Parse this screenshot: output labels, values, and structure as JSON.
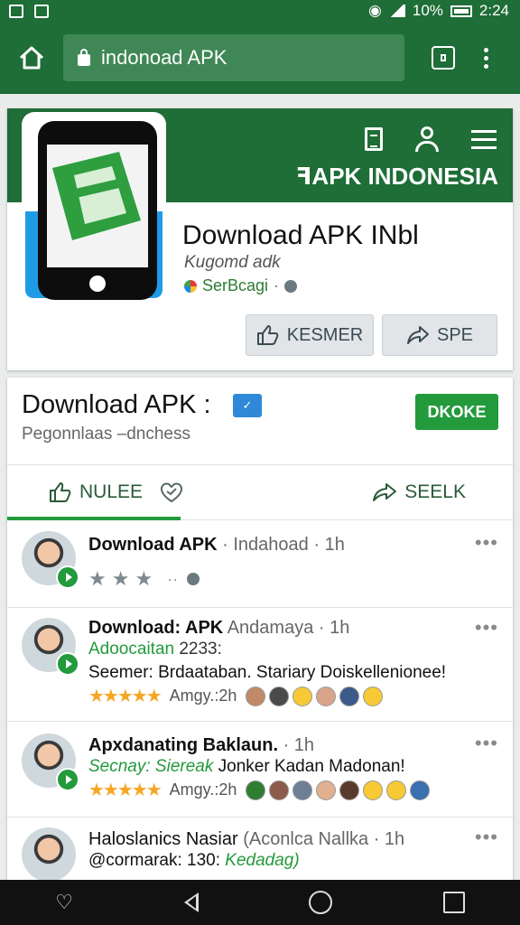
{
  "status_bar": {
    "battery": "10%",
    "time": "2:24"
  },
  "browser": {
    "url_text": "indonoad APK"
  },
  "header": {
    "brand": "ꟻAPK INDONESIA",
    "app_title": "Download APK INbl",
    "app_subtitle": "Kugomd adk",
    "app_meta": "SerBcagi",
    "btn_left": "KESMER",
    "btn_right": "SPE"
  },
  "page": {
    "title": "Download APK :",
    "subtitle": "Pegonnlaas –dnchess",
    "cta": "DKOKE",
    "tab_like": "NULEE",
    "tab_share": "SEELK"
  },
  "posts": [
    {
      "author": "Download APK",
      "meta": "· Indahoad · 1h"
    },
    {
      "author": "Download: APK",
      "meta": "Andamaya · 1h",
      "line1_a": "Adoocaitan",
      "line1_b": "2233:",
      "text": "Seemer: Brdaataban. Stariary Doiskellenionee!",
      "time": "Amgy.:2h"
    },
    {
      "author": "Apxdanating Baklaun.",
      "meta": "· 1h",
      "line1_a": "Secnay: Siereak",
      "text": "Jonker Kadan Madonan!",
      "time": "Amgy.:2h"
    },
    {
      "author": "Haloslanics Nasiar",
      "meta": "(Aconlca Nallka · 1h",
      "line1_a": "@cormarak: 130:",
      "line1_b": "Kedadag)"
    }
  ],
  "colors": {
    "brand_green": "#1f6d37",
    "accent_green": "#239a3b",
    "star": "#f5a623"
  }
}
